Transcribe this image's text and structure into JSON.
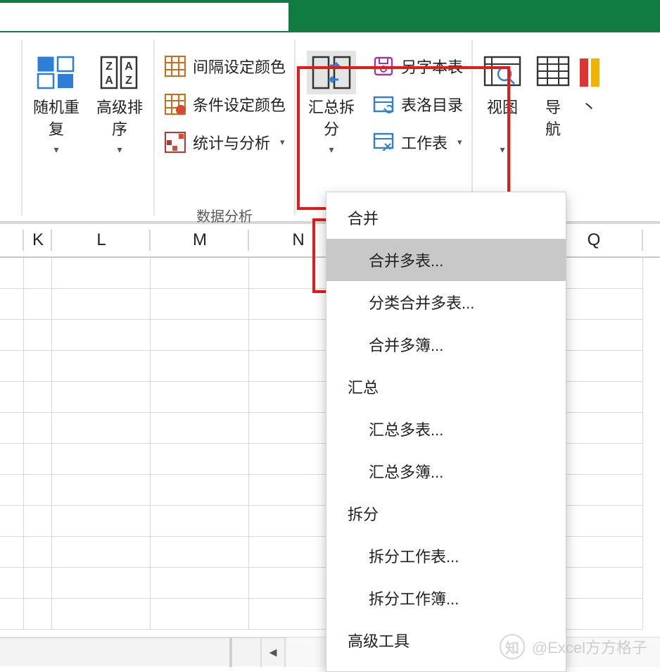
{
  "ribbon": {
    "group1": {
      "randomRepeat": {
        "line1": "随机重",
        "line2": "复"
      },
      "advancedSort": {
        "line1": "高级排",
        "line2": "序"
      }
    },
    "group2": {
      "intervalColor": "间隔设定颜色",
      "conditionalColor": "条件设定颜色",
      "statsAnalyze": "统计与分析",
      "groupLabel": "数据分析"
    },
    "group3": {
      "summarySplit": {
        "line1": "汇总拆",
        "line2": "分"
      },
      "saveAsThisTable": "另字本表",
      "tableDirectory": "表洛目录",
      "worksheet": "工作表"
    },
    "group4": {
      "view": "视图",
      "navigate": {
        "line1": "导",
        "line2": "航"
      }
    }
  },
  "dropdown": {
    "sec1": "合并",
    "item1": "合并多表...",
    "item2": "分类合并多表...",
    "item3": "合并多簿...",
    "sec2": "汇总",
    "item4": "汇总多表...",
    "item5": "汇总多簿...",
    "sec3": "拆分",
    "item6": "拆分工作表...",
    "item7": "拆分工作簿...",
    "sec4": "高级工具"
  },
  "columns": [
    "K",
    "L",
    "M",
    "N",
    "",
    "",
    "Q"
  ],
  "watermark": "@Excel方方格子"
}
